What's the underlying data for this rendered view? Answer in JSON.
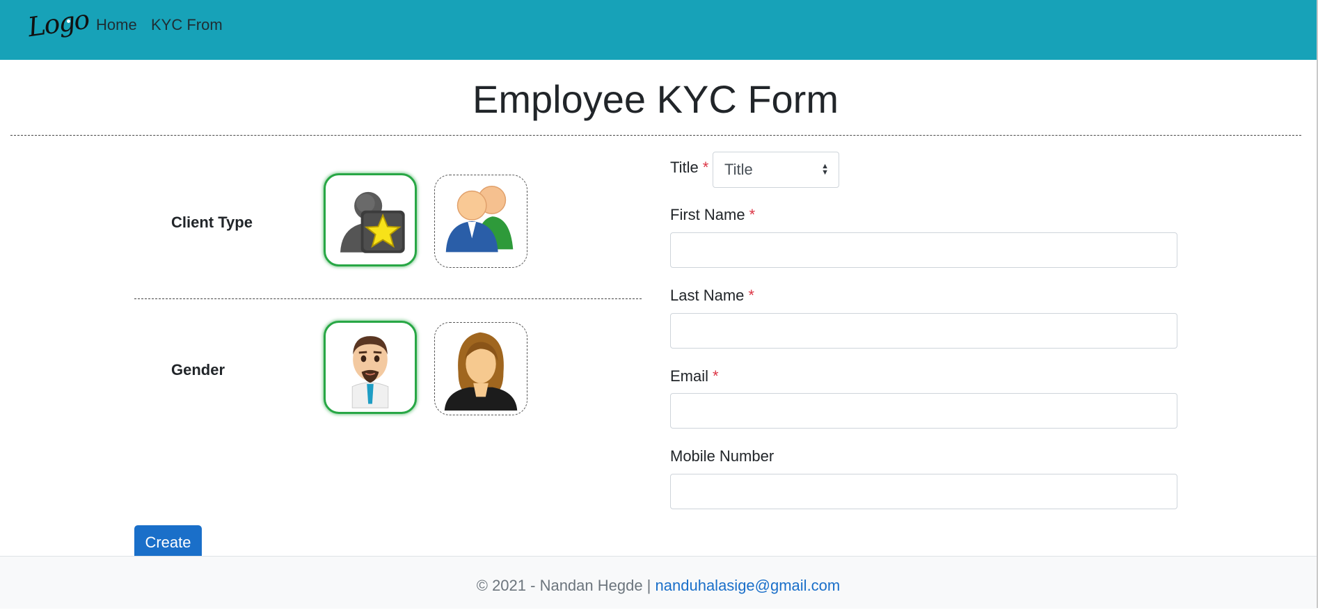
{
  "navbar": {
    "logo_text": "Logo",
    "links": [
      "Home",
      "KYC From"
    ]
  },
  "page": {
    "title": "Employee KYC Form"
  },
  "client_type": {
    "label": "Client Type",
    "options": [
      {
        "icon": "vip-user-icon",
        "selected": true
      },
      {
        "icon": "group-users-icon",
        "selected": false
      }
    ]
  },
  "gender": {
    "label": "Gender",
    "options": [
      {
        "icon": "male-avatar-icon",
        "selected": true
      },
      {
        "icon": "female-avatar-icon",
        "selected": false
      }
    ]
  },
  "form": {
    "title_label": "Title",
    "title_select_value": "Title",
    "first_name_label": "First Name",
    "last_name_label": "Last Name",
    "email_label": "Email",
    "mobile_label": "Mobile Number",
    "required_marker": "*",
    "first_name_value": "",
    "last_name_value": "",
    "email_value": "",
    "mobile_value": ""
  },
  "actions": {
    "create_label": "Create"
  },
  "footer": {
    "copyright": "© 2021 - Nandan Hegde |",
    "email": "nanduhalasige@gmail.com"
  },
  "colors": {
    "navbar": "#17a2b8",
    "selected_border": "#28a745",
    "required": "#dc3545",
    "primary": "#1a6fc9"
  }
}
